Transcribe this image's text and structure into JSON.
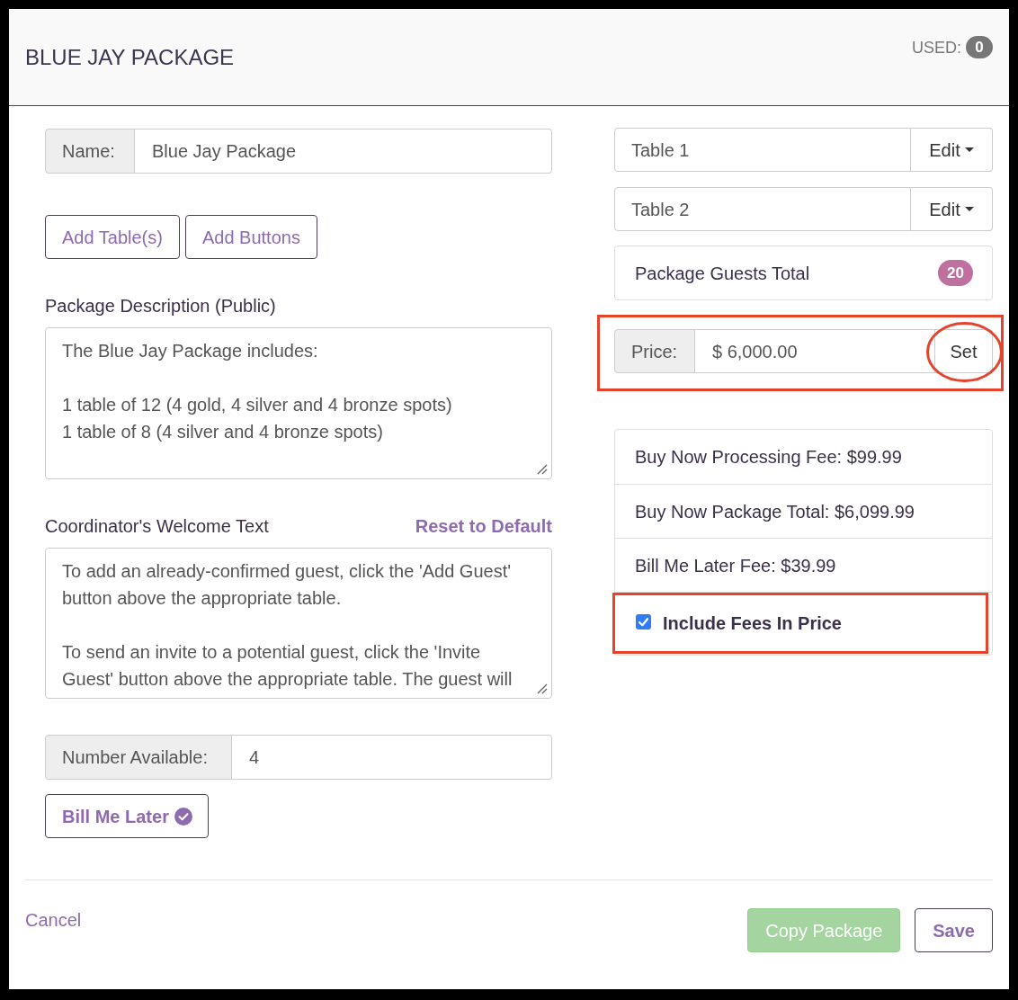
{
  "header": {
    "title": "BLUE JAY PACKAGE",
    "used_label": "USED:",
    "used_count": "0"
  },
  "left": {
    "name_field": {
      "label": "Name:",
      "value": "Blue Jay Package"
    },
    "action_buttons": [
      "Add Table(s)",
      "Add Buttons"
    ],
    "description": {
      "label": "Package Description (Public)",
      "value": "The Blue Jay Package includes:\n\n1 table of 12 (4 gold, 4 silver and 4 bronze spots)\n1 table of 8 (4 silver and 4 bronze spots)"
    },
    "welcome_text": {
      "label": "Coordinator's Welcome Text",
      "reset_link": "Reset to Default",
      "value": "To add an already-confirmed guest, click the 'Add Guest' button above the appropriate table.\n\nTo send an invite to a potential guest, click the 'Invite Guest' button above the appropriate table. The guest will"
    },
    "number_available": {
      "label": "Number Available:",
      "value": "4"
    },
    "bill_me_later": {
      "label": "Bill Me Later",
      "checked": true
    }
  },
  "right": {
    "tables": [
      {
        "name": "Table 1",
        "action": "Edit"
      },
      {
        "name": "Table 2",
        "action": "Edit"
      }
    ],
    "guests_total": {
      "label": "Package Guests Total",
      "count": "20"
    },
    "price": {
      "label": "Price:",
      "value": "$ 6,000.00",
      "button": "Set",
      "highlighted": true,
      "button_circled": true
    },
    "fees": [
      {
        "kind": "text",
        "text": "Buy Now Processing Fee: $99.99"
      },
      {
        "kind": "text",
        "text": "Buy Now Package Total: $6,099.99"
      },
      {
        "kind": "text",
        "text": "Bill Me Later Fee: $39.99"
      },
      {
        "kind": "checkbox",
        "label": "Include Fees In Price",
        "checked": true,
        "highlighted": true
      }
    ]
  },
  "footer": {
    "cancel": "Cancel",
    "buttons": [
      {
        "label": "Copy Package",
        "kind": "success",
        "disabled": true
      },
      {
        "label": "Save",
        "kind": "outline",
        "disabled": false
      }
    ]
  }
}
